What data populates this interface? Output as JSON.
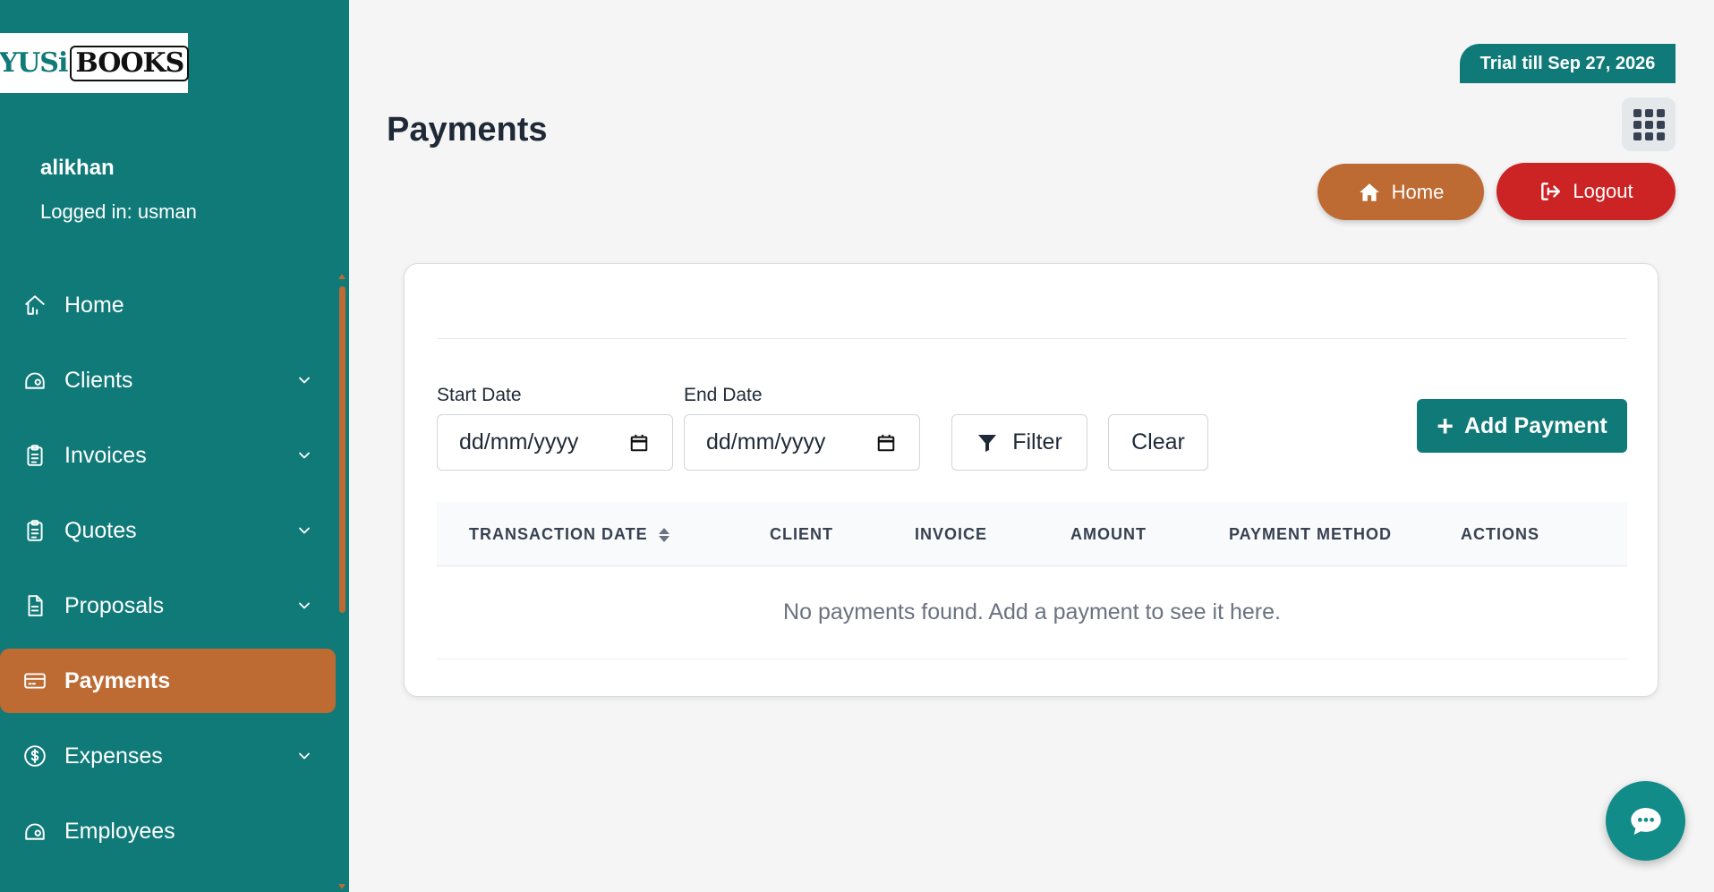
{
  "brand": {
    "logo_left": "YUSi",
    "logo_right": "BOOKS"
  },
  "user": {
    "name": "alikhan",
    "logged_in": "Logged in: usman"
  },
  "sidebar": {
    "items": [
      {
        "label": "Home",
        "icon": "home-icon",
        "has_chevron": false
      },
      {
        "label": "Clients",
        "icon": "clients-icon",
        "has_chevron": true
      },
      {
        "label": "Invoices",
        "icon": "clipboard-icon",
        "has_chevron": true
      },
      {
        "label": "Quotes",
        "icon": "clipboard-icon",
        "has_chevron": true
      },
      {
        "label": "Proposals",
        "icon": "document-icon",
        "has_chevron": true
      },
      {
        "label": "Payments",
        "icon": "credit-card-icon",
        "has_chevron": false,
        "active": true
      },
      {
        "label": "Expenses",
        "icon": "dollar-circle-icon",
        "has_chevron": true
      },
      {
        "label": "Employees",
        "icon": "employees-icon",
        "has_chevron": false
      }
    ]
  },
  "header": {
    "trial": "Trial till Sep 27, 2026",
    "title": "Payments",
    "home_label": "Home",
    "logout_label": "Logout"
  },
  "filters": {
    "start_label": "Start Date",
    "start_value": "dd/mm/yyyy",
    "end_label": "End Date",
    "end_value": "dd/mm/yyyy",
    "filter_label": "Filter",
    "clear_label": "Clear",
    "add_label": "Add Payment"
  },
  "table": {
    "columns": [
      "TRANSACTION DATE",
      "CLIENT",
      "INVOICE",
      "AMOUNT",
      "PAYMENT METHOD",
      "ACTIONS"
    ],
    "rows": [],
    "empty_message": "No payments found. Add a payment to see it here."
  },
  "colors": {
    "sidebar_bg": "#0f7a78",
    "accent_orange": "#bd6a33",
    "logout_red": "#cc2424",
    "primary_teal": "#0f7a78"
  }
}
